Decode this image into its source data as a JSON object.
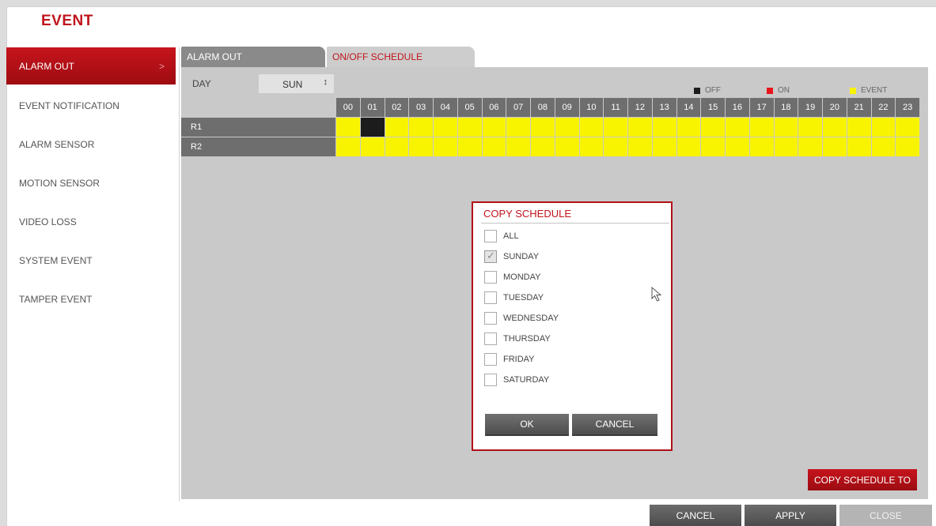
{
  "app": {
    "title": "EVENT"
  },
  "sidebar": {
    "items": [
      {
        "label": "ALARM OUT",
        "active": true
      },
      {
        "label": "EVENT NOTIFICATION"
      },
      {
        "label": "ALARM SENSOR"
      },
      {
        "label": "MOTION SENSOR"
      },
      {
        "label": "VIDEO LOSS"
      },
      {
        "label": "SYSTEM EVENT"
      },
      {
        "label": "TAMPER EVENT"
      }
    ],
    "active_chevron": ">"
  },
  "tabs": [
    {
      "label": "ALARM OUT",
      "active": false
    },
    {
      "label": "ON/OFF SCHEDULE",
      "active": true
    }
  ],
  "schedule": {
    "day_label": "DAY",
    "day_value": "SUN",
    "spinner_glyph": "↕",
    "legend": [
      {
        "label": "OFF",
        "color": "#1c1c1c"
      },
      {
        "label": "ON",
        "color": "#e8141c"
      },
      {
        "label": "EVENT",
        "color": "#f8f400"
      }
    ],
    "hours": [
      "00",
      "01",
      "02",
      "03",
      "04",
      "05",
      "06",
      "07",
      "08",
      "09",
      "10",
      "11",
      "12",
      "13",
      "14",
      "15",
      "16",
      "17",
      "18",
      "19",
      "20",
      "21",
      "22",
      "23"
    ],
    "rows": [
      {
        "label": "R1",
        "cells": [
          "event",
          "off",
          "event",
          "event",
          "event",
          "event",
          "event",
          "event",
          "event",
          "event",
          "event",
          "event",
          "event",
          "event",
          "event",
          "event",
          "event",
          "event",
          "event",
          "event",
          "event",
          "event",
          "event",
          "event"
        ]
      },
      {
        "label": "R2",
        "cells": [
          "event",
          "event",
          "event",
          "event",
          "event",
          "event",
          "event",
          "event",
          "event",
          "event",
          "event",
          "event",
          "event",
          "event",
          "event",
          "event",
          "event",
          "event",
          "event",
          "event",
          "event",
          "event",
          "event",
          "event"
        ]
      }
    ]
  },
  "dialog": {
    "title": "COPY SCHEDULE",
    "options": [
      {
        "label": "ALL",
        "checked": false
      },
      {
        "label": "SUNDAY",
        "checked": true
      },
      {
        "label": "MONDAY",
        "checked": false
      },
      {
        "label": "TUESDAY",
        "checked": false
      },
      {
        "label": "WEDNESDAY",
        "checked": false
      },
      {
        "label": "THURSDAY",
        "checked": false
      },
      {
        "label": "FRIDAY",
        "checked": false
      },
      {
        "label": "SATURDAY",
        "checked": false
      }
    ],
    "ok_label": "OK",
    "cancel_label": "CANCEL"
  },
  "actions": {
    "copy_schedule_to": "COPY SCHEDULE TO",
    "cancel": "CANCEL",
    "apply": "APPLY",
    "close": "CLOSE"
  },
  "colors": {
    "accent": "#c0141c",
    "event": "#f8f400",
    "off": "#1c1c1c",
    "on": "#e8141c"
  }
}
